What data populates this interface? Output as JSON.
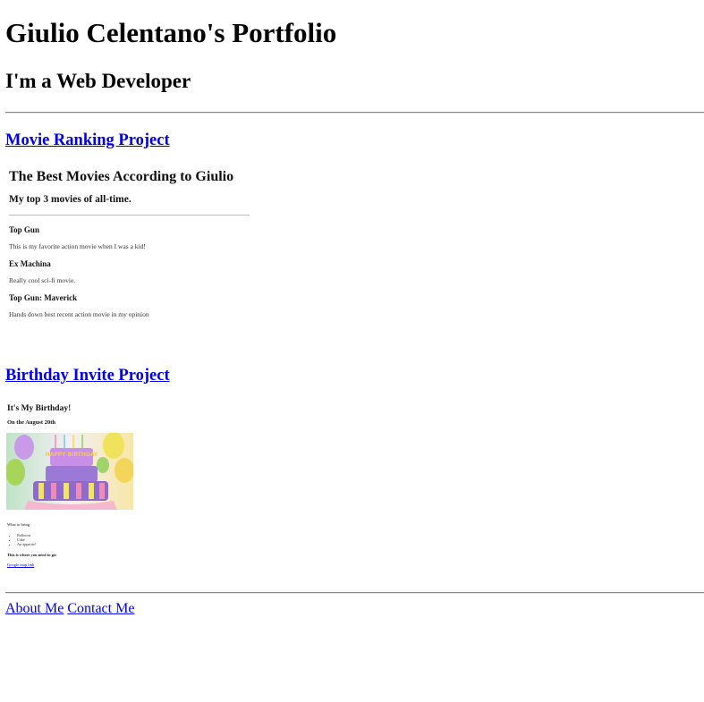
{
  "header": {
    "title": "Giulio Celentano's Portfolio",
    "subtitle": "I'm a Web Developer"
  },
  "projects": [
    {
      "link_text": "Movie Ranking Project",
      "preview": {
        "title": "The Best Movies According to Giulio",
        "subtitle": "My top 3 movies of all-time.",
        "movies": [
          {
            "name": "Top Gun",
            "desc": "This is my favorite action movie when I was a kid!"
          },
          {
            "name": "Ex Machina",
            "desc": "Really cool sci-fi movie."
          },
          {
            "name": "Top Gun: Maverick",
            "desc": "Hands down best recent action movie in my opinion"
          }
        ]
      }
    },
    {
      "link_text": "Birthday Invite Project",
      "preview": {
        "title": "It's My Birthday!",
        "subtitle": "On the August 20th",
        "cake_text": "HAPPY BIRTHDAY",
        "bring_heading": "What to bring:",
        "bring_items": [
          "Balloons",
          "Cake",
          "An appetite!"
        ],
        "where_heading": "This is where you need to go:",
        "map_link": "Google map link"
      }
    }
  ],
  "footer": {
    "links": [
      "About Me",
      "Contact Me"
    ]
  }
}
